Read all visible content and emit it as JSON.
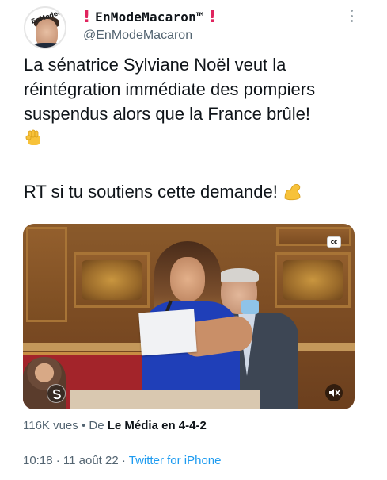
{
  "author": {
    "display_name": "EnModeMacaron™",
    "prefix_mark": "!",
    "suffix_mark": "!",
    "handle": "@EnModeMacaron",
    "avatar_text": "EnModeMacaron"
  },
  "tweet": {
    "text": "La sénatrice Sylviane Noël veut la réintégration immédiate des pompiers suspendus alors que la France brûle!",
    "text_emoji": "raised-fist-emoji",
    "call_to_action": "RT si tu soutiens cette demande!",
    "call_to_action_emoji": "flexed-biceps-emoji"
  },
  "video": {
    "cc_label": "cc",
    "mute_icon": "speaker-muted-icon",
    "watermark_icon": "s-logo-icon"
  },
  "meta": {
    "views": "116K vues",
    "separator": "•",
    "source_prefix": "De",
    "source_name": "Le Média en 4-4-2",
    "time": "10:18",
    "dot": "·",
    "date": "11 août 22",
    "client": "Twitter for iPhone"
  },
  "colors": {
    "name_mark": "#e0245e",
    "link": "#1d9bf0",
    "secondary_text": "#536471"
  }
}
